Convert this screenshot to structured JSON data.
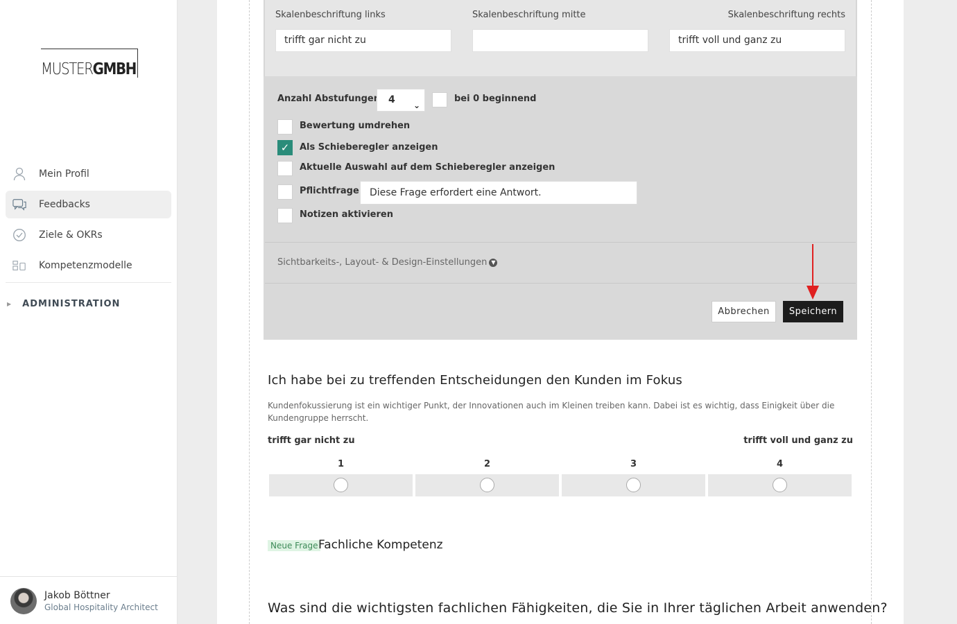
{
  "brand": {
    "logo_thin": "MUSTER",
    "logo_bold": "GMBH"
  },
  "sidebar": {
    "items": [
      {
        "label": "Mein Profil",
        "icon": "user-icon"
      },
      {
        "label": "Feedbacks",
        "icon": "chat-icon",
        "active": true
      },
      {
        "label": "Ziele & OKRs",
        "icon": "target-check-icon"
      },
      {
        "label": "Kompetenzmodelle",
        "icon": "grid-icon"
      }
    ],
    "admin_label": "ADMINISTRATION",
    "user": {
      "name": "Jakob Böttner",
      "role": "Global Hospitality Architect"
    }
  },
  "editor": {
    "scale_labels": {
      "left_label": "Skalenbeschriftung links",
      "middle_label": "Skalenbeschriftung mitte",
      "right_label": "Skalenbeschriftung rechts",
      "left_value": "trifft gar nicht zu",
      "middle_value": "",
      "right_value": "trifft voll und ganz zu"
    },
    "steps_label": "Anzahl Abstufungen",
    "steps_value": "4",
    "zero_start_label": "bei 0 beginnend",
    "options": {
      "reverse": "Bewertung umdrehen",
      "slider": "Als Schieberegler anzeigen",
      "slider_value": "Aktuelle Auswahl auf dem Schieberegler anzeigen",
      "required": "Pflichtfrage",
      "required_text": "Diese Frage erfordert eine Antwort.",
      "notes": "Notizen aktivieren"
    },
    "visibility_link": "Sichtbarkeits-, Layout- & Design-Einstellungen",
    "cancel": "Abbrechen",
    "save": "Speichern"
  },
  "question": {
    "title": "Ich habe bei zu treffenden Entscheidungen den Kunden im Fokus",
    "description": "Kundenfokussierung ist ein wichtiger Punkt, der Innovationen auch im Kleinen treiben kann. Dabei ist es wichtig, dass Einigkeit über die Kundengruppe herrscht.",
    "scale_left": "trifft gar nicht zu",
    "scale_right": "trifft voll und ganz zu",
    "scale_points": [
      "1",
      "2",
      "3",
      "4"
    ]
  },
  "new_question": {
    "badge": "Neue Frage",
    "title": "Fachliche Kompetenz"
  },
  "next_question": {
    "title": "Was sind die wichtigsten fachlichen Fähigkeiten, die Sie in Ihrer täglichen Arbeit anwenden?"
  },
  "colors": {
    "accent": "#2a8c7a",
    "annotation": "#e02020",
    "save_button": "#1c1c1c"
  }
}
